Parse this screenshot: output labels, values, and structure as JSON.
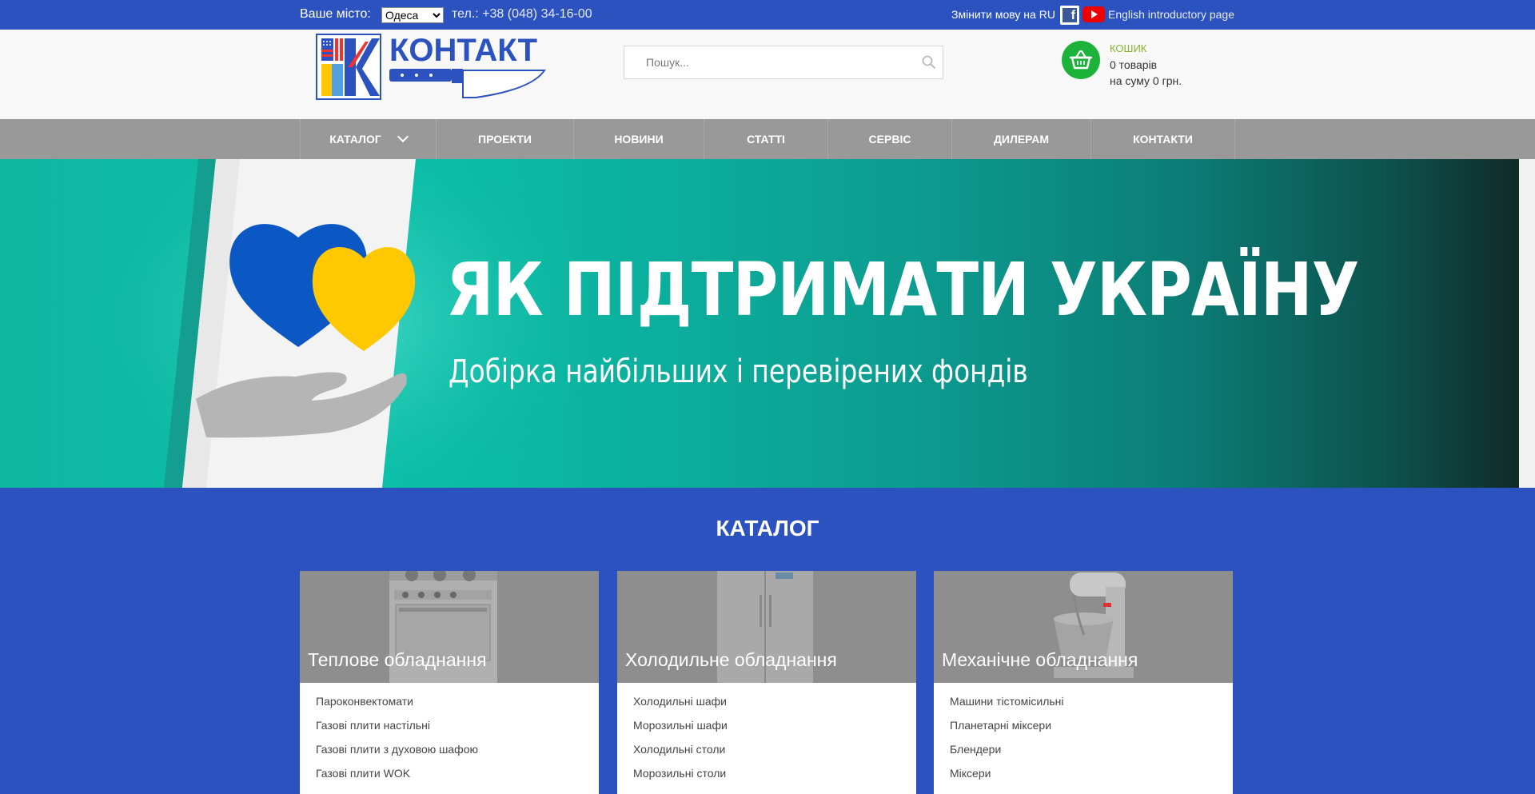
{
  "topbar": {
    "city_label": "Ваше місто:",
    "city_selected": "Одеса",
    "phone": "тел.: +38 (048) 34-16-00",
    "lang_switch": "Змінити мову на RU",
    "english_link": "English introductory page",
    "facebook_icon": "facebook-icon",
    "youtube_icon": "youtube-icon"
  },
  "header": {
    "logo_text": "КОНТАКТ",
    "search_placeholder": "Пошук...",
    "cart": {
      "title": "КОШИК",
      "items": "0 товарів",
      "sum": "на суму 0 грн."
    }
  },
  "nav": {
    "items": [
      {
        "label": "КАТАЛОГ"
      },
      {
        "label": "ПРОЕКТИ"
      },
      {
        "label": "НОВИНИ"
      },
      {
        "label": "СТАТТІ"
      },
      {
        "label": "СЕРВІС"
      },
      {
        "label": "ДИЛЕРАМ"
      },
      {
        "label": "КОНТАКТИ"
      }
    ]
  },
  "banner": {
    "title": "ЯК ПІДТРИМАТИ УКРАЇНУ",
    "subtitle": "Добірка найбільших і перевірених фондів"
  },
  "catalog": {
    "title": "КАТАЛОГ",
    "cards": [
      {
        "title": "Теплове обладнання",
        "items": [
          "Пароконвектомати",
          "Газові плити настільні",
          "Газові плити з духовою шафою",
          "Газові плити WOK"
        ]
      },
      {
        "title": "Холодильне обладнання",
        "items": [
          "Холодильні шафи",
          "Морозильні шафи",
          "Холодильні столи",
          "Морозильні столи"
        ]
      },
      {
        "title": "Механічне обладнання",
        "items": [
          "Машини тістомісильні",
          "Планетарні міксери",
          "Блендери",
          "Міксери"
        ]
      }
    ]
  },
  "colors": {
    "brand_blue": "#2b52bf",
    "cart_green": "#1db239",
    "nav_gray": "#999999",
    "banner_teal": "#0bb8a3",
    "heart_blue": "#0b57c4",
    "heart_yellow": "#ffc800"
  }
}
